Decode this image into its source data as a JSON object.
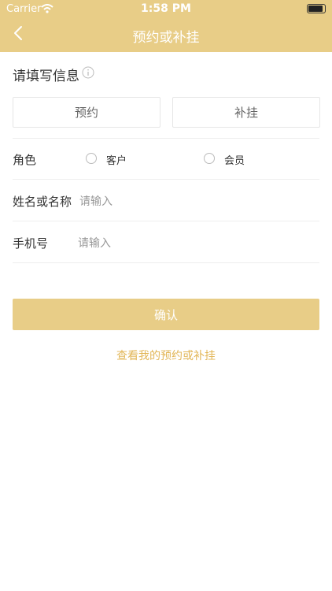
{
  "status_bar": {
    "carrier": "Carrier",
    "time": "1:58 PM",
    "battery": 1.0
  },
  "nav": {
    "title": "预约或补挂"
  },
  "form": {
    "section_title": "请填写信息",
    "tabs": [
      {
        "label": "预约"
      },
      {
        "label": "补挂"
      }
    ],
    "role": {
      "label": "角色",
      "options": [
        {
          "label": "客户"
        },
        {
          "label": "会员"
        }
      ]
    },
    "name": {
      "label": "姓名或名称",
      "placeholder": "请输入"
    },
    "phone": {
      "label": "手机号",
      "placeholder": "请输入"
    },
    "confirm_label": "确认",
    "link_label": "查看我的预约或补挂"
  },
  "colors": {
    "accent": "#e8cd87",
    "link": "#e2b657"
  }
}
